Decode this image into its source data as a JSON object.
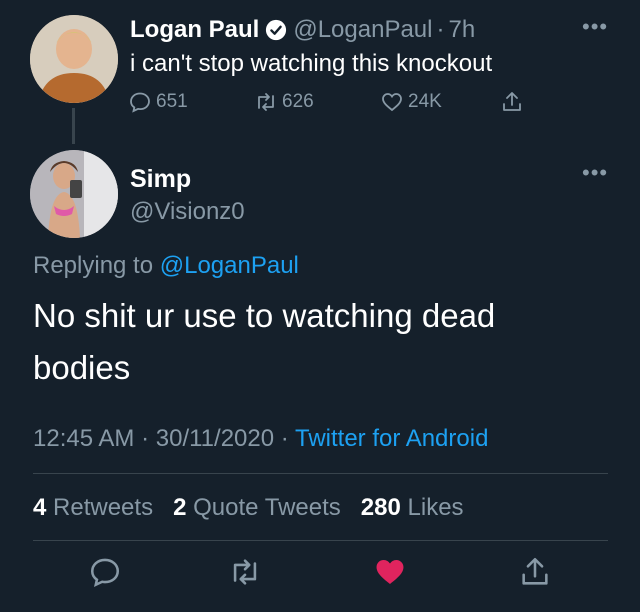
{
  "parent_tweet": {
    "name": "Logan Paul",
    "handle": "@LoganPaul",
    "separator": "·",
    "time": "7h",
    "text": "i can't stop watching this knockout",
    "replies": "651",
    "retweets": "626",
    "likes": "24K"
  },
  "reply_tweet": {
    "name": "Simp",
    "handle": "@Visionz0",
    "replying_prefix": "Replying to",
    "replying_handle": "@LoganPaul",
    "text": "No shit ur use to watching dead bodies",
    "time": "12:45 AM",
    "date": "30/11/2020",
    "separator": "·",
    "source": "Twitter for Android",
    "retweet_count": "4",
    "retweet_label": "Retweets",
    "quote_count": "2",
    "quote_label": "Quote Tweets",
    "like_count": "280",
    "like_label": "Likes",
    "liked": true
  },
  "colors": {
    "background": "#15202b",
    "muted": "#8899a6",
    "link": "#1da1f2",
    "like_active": "#e0245e"
  }
}
